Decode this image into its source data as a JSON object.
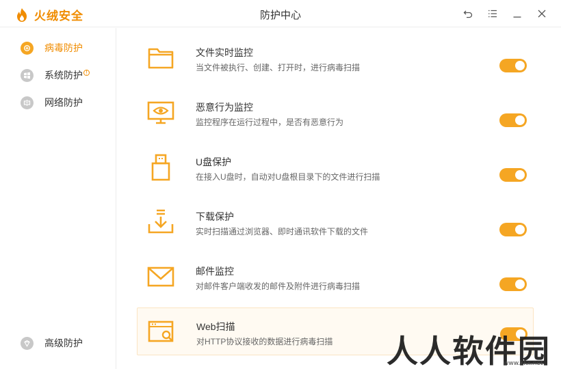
{
  "app": {
    "brand": "火绒安全",
    "window_title": "防护中心",
    "accent_color": "#f5a623",
    "brand_color": "#f08c00"
  },
  "window_controls": [
    {
      "name": "back-icon"
    },
    {
      "name": "menu-icon"
    },
    {
      "name": "minimize-icon"
    },
    {
      "name": "close-icon"
    }
  ],
  "sidebar": {
    "items": [
      {
        "label": "病毒防护",
        "icon": "virus-shield-icon",
        "active": true
      },
      {
        "label": "系统防护",
        "icon": "windows-icon",
        "badge": "!",
        "active": false
      },
      {
        "label": "网络防护",
        "icon": "network-icon",
        "active": false
      }
    ],
    "bottom_item": {
      "label": "高级防护",
      "icon": "advanced-shield-icon"
    }
  },
  "features": [
    {
      "title": "文件实时监控",
      "desc": "当文件被执行、创建、打开时，进行病毒扫描",
      "icon": "folder-icon",
      "enabled": true
    },
    {
      "title": "恶意行为监控",
      "desc": "监控程序在运行过程中，是否有恶意行为",
      "icon": "monitor-eye-icon",
      "enabled": true
    },
    {
      "title": "U盘保护",
      "desc": "在接入U盘时，自动对U盘根目录下的文件进行扫描",
      "icon": "usb-icon",
      "enabled": true
    },
    {
      "title": "下载保护",
      "desc": "实时扫描通过浏览器、即时通讯软件下载的文件",
      "icon": "download-icon",
      "enabled": true
    },
    {
      "title": "邮件监控",
      "desc": "对邮件客户端收发的邮件及附件进行病毒扫描",
      "icon": "mail-icon",
      "enabled": true
    },
    {
      "title": "Web扫描",
      "desc": "对HTTP协议接收的数据进行病毒扫描",
      "icon": "web-scan-icon",
      "enabled": true
    }
  ],
  "watermark": {
    "text": "人人软件园",
    "sub": "www.kkx.net"
  }
}
